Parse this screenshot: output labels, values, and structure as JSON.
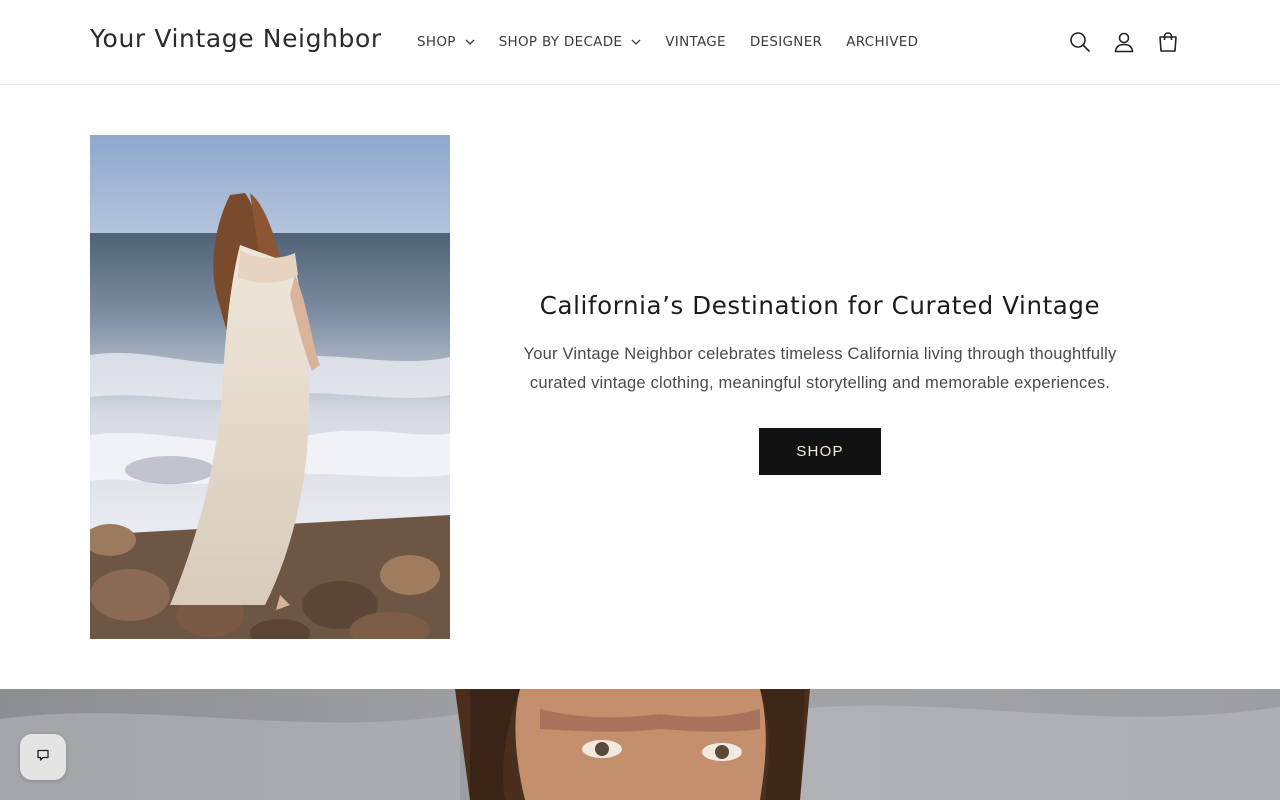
{
  "header": {
    "logo": "Your Vintage Neighbor",
    "nav": [
      {
        "label": "SHOP",
        "has_dropdown": true
      },
      {
        "label": "SHOP BY DECADE",
        "has_dropdown": true
      },
      {
        "label": "VINTAGE",
        "has_dropdown": false
      },
      {
        "label": "DESIGNER",
        "has_dropdown": false
      },
      {
        "label": "ARCHIVED",
        "has_dropdown": false
      }
    ],
    "icons": [
      "search-icon",
      "account-icon",
      "cart-icon"
    ]
  },
  "hero": {
    "title": "California’s Destination for Curated Vintage",
    "description": "Your Vintage Neighbor celebrates timeless California living through thoughtfully curated vintage clothing, meaningful storytelling and memorable experiences.",
    "button_label": "SHOP"
  },
  "chat": {
    "icon": "chat-icon"
  },
  "colors": {
    "button_bg": "#121212",
    "button_text": "#f4ead8",
    "text": "#121212"
  }
}
